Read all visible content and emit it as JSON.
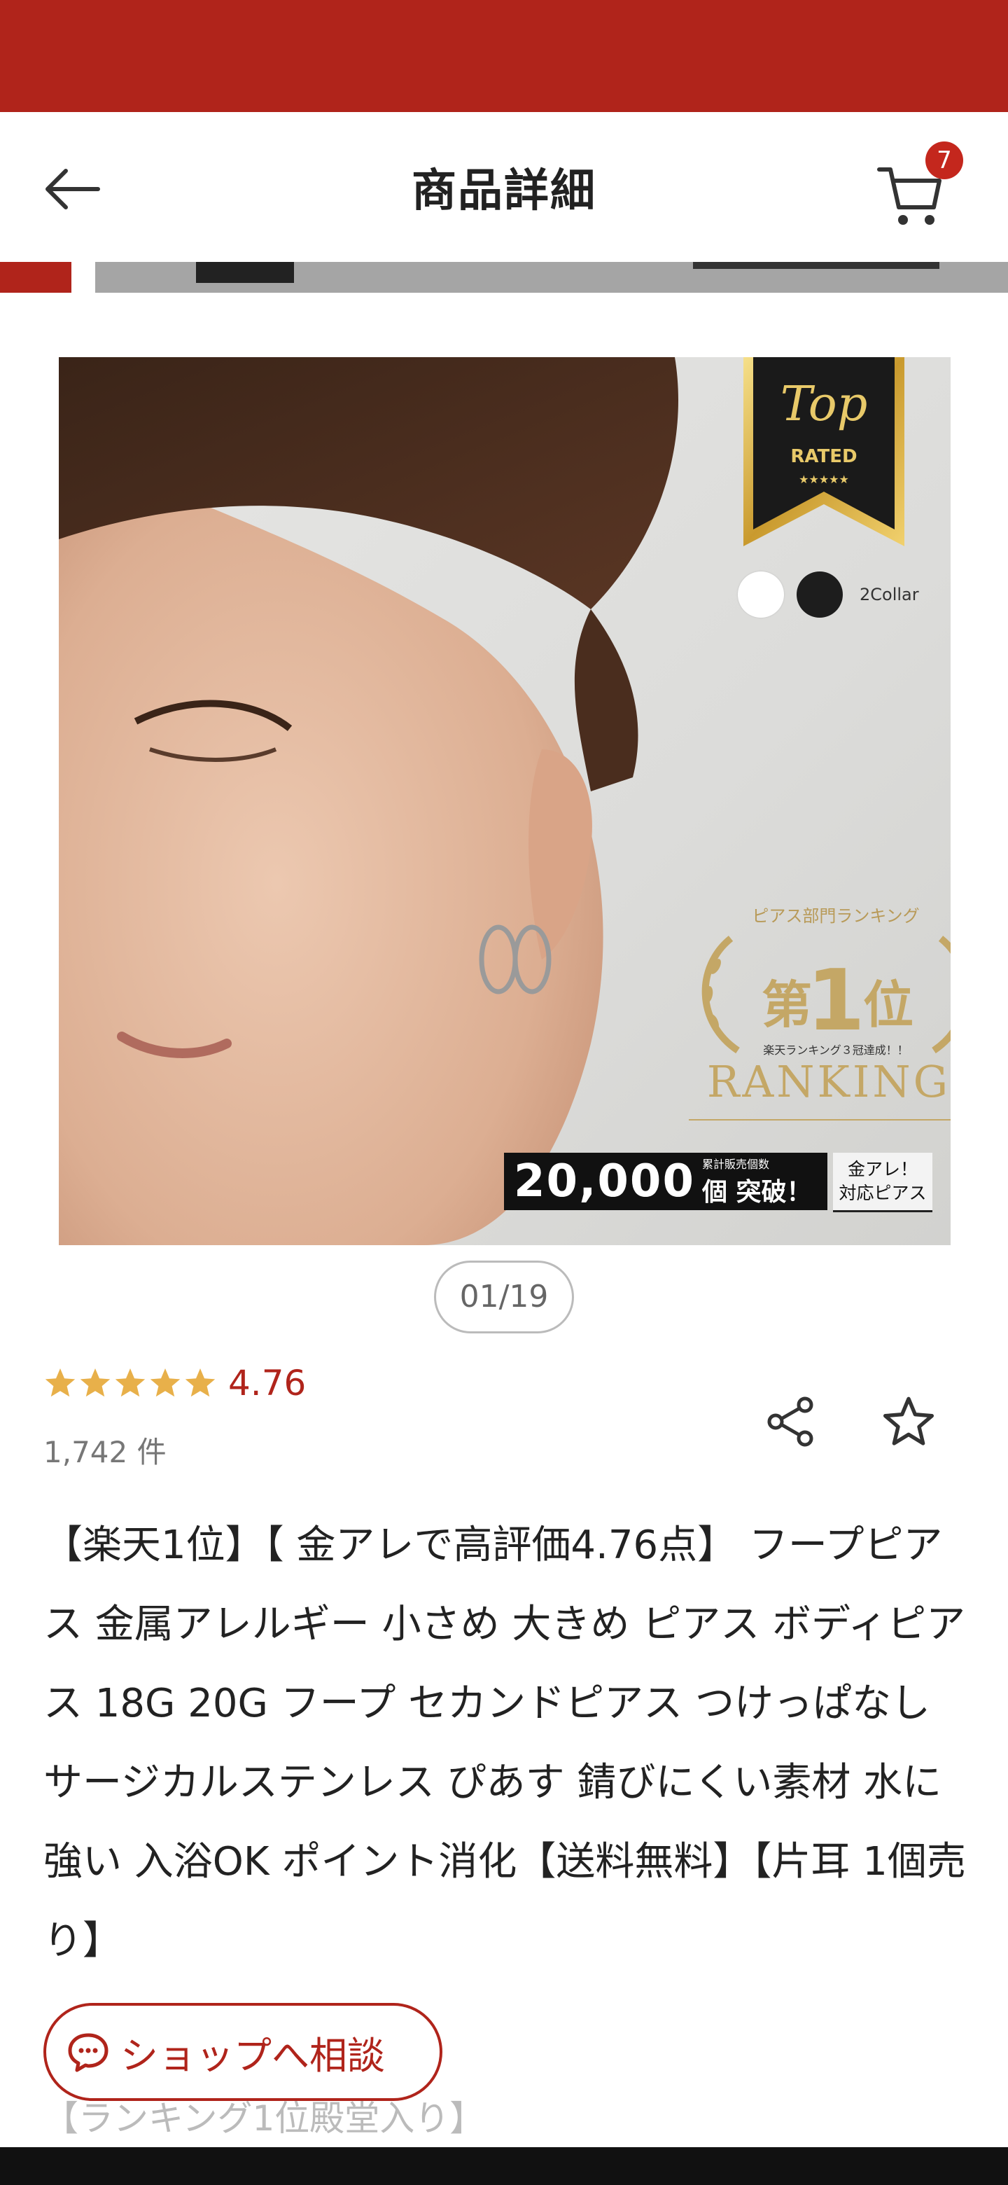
{
  "header": {
    "title": "商品詳細",
    "cart_count": "7"
  },
  "gallery": {
    "counter": "01/19",
    "overlay": {
      "badge_line1": "Top",
      "badge_line2": "RATED",
      "badge_stars": "★★★★★",
      "color_label": "2Collar",
      "ranking_sub": "ピアス部門ランキング",
      "ranking_prefix": "第",
      "ranking_rank": "1",
      "ranking_suffix": "位",
      "ranking_note": "楽天ランキング３冠達成！！",
      "ranking_eng": "RANKING",
      "sales_number": "20,000",
      "sales_top": "累計販売個数",
      "sales_bottom": "個 突破！",
      "kinare_1": "金アレ！",
      "kinare_2": "対応ピアス"
    }
  },
  "rating": {
    "value": "4.76",
    "stars": 5,
    "count": "1,742 件"
  },
  "product": {
    "title": "【楽天1位】【 金アレで高評価4.76点】 フープピアス 金属アレルギー 小さめ 大きめ ピアス ボディピアス 18G 20G フープ セカンドピアス つけっぱなし サージカルステンレス ぴあす 錆びにくい素材 水に強い 入浴OK ポイント消化【送料無料】【片耳 1個売り】",
    "subtitle": "【ランキング1位殿堂入り】"
  },
  "shop_button": {
    "label": "ショップへ相談"
  },
  "colors": {
    "accent": "#b0241b",
    "star": "#e8b04a"
  }
}
